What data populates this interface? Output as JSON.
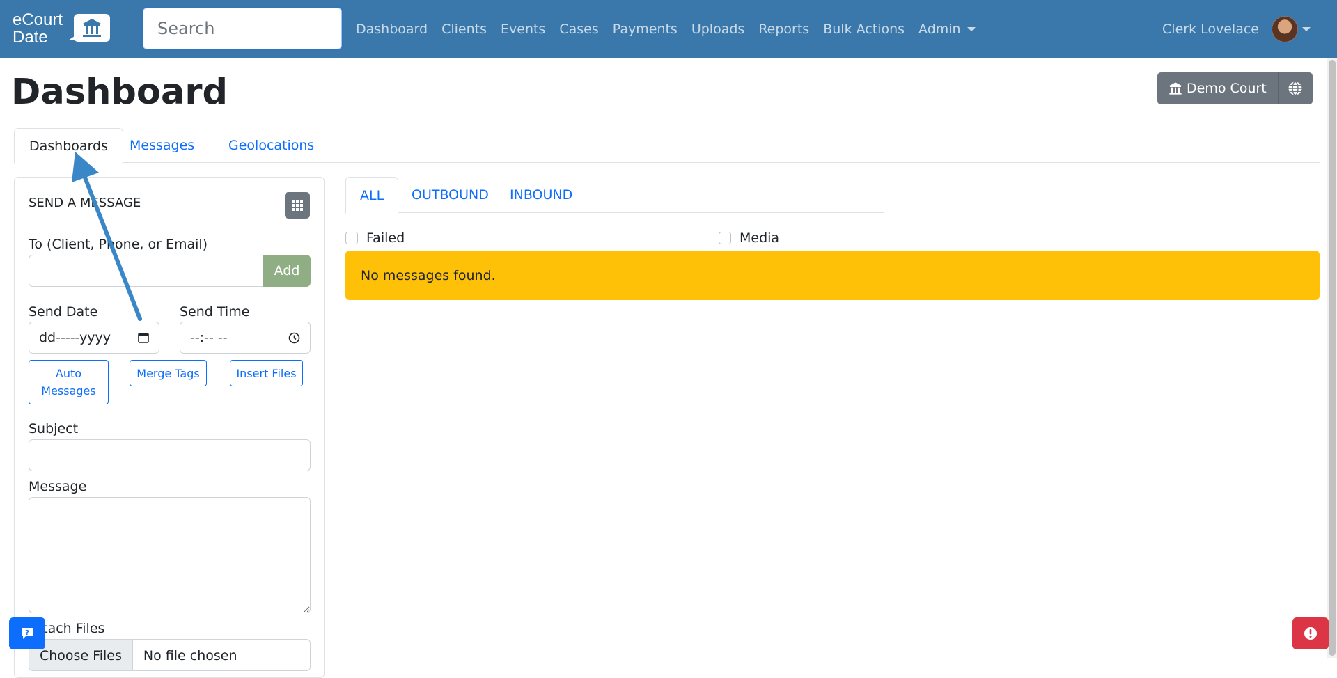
{
  "brand": {
    "line1": "eCourt",
    "line2": "Date"
  },
  "search": {
    "placeholder": "Search"
  },
  "nav": {
    "items": [
      "Dashboard",
      "Clients",
      "Events",
      "Cases",
      "Payments",
      "Uploads",
      "Reports",
      "Bulk Actions",
      "Admin"
    ]
  },
  "user": {
    "name": "Clerk Lovelace"
  },
  "page": {
    "title": "Dashboard"
  },
  "court": {
    "label": "Demo Court"
  },
  "tabs": [
    "Dashboards",
    "Messages",
    "Geolocations"
  ],
  "send": {
    "title": "SEND A MESSAGE",
    "to_label": "To (Client, Phone, or Email)",
    "add_label": "Add",
    "send_date_label": "Send Date",
    "date_placeholder": "dd-----yyyy",
    "send_time_label": "Send Time",
    "time_placeholder": "--:-- --",
    "auto_messages": "Auto Messages",
    "merge_tags": "Merge Tags",
    "insert_files": "Insert Files",
    "subject_label": "Subject",
    "message_label": "Message",
    "attach_label": "Attach Files",
    "choose_files": "Choose Files",
    "no_file": "No file chosen"
  },
  "messages": {
    "tabs": [
      "ALL",
      "OUTBOUND",
      "INBOUND"
    ],
    "filter_failed": "Failed",
    "filter_media": "Media",
    "empty_text": "No messages found."
  },
  "colors": {
    "navbar": "#3a78ab",
    "alert": "#ffc107",
    "link": "#0d6efd",
    "add_button": "#8fae83",
    "danger": "#dc3545",
    "arrow": "#3a87c8"
  }
}
